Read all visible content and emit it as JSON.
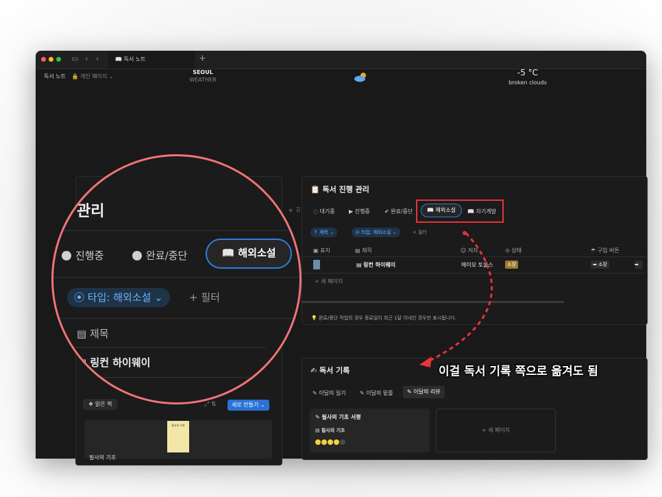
{
  "tab": {
    "title": "독서 노트"
  },
  "breadcrumb": {
    "page": "독서 노트",
    "workspace": "개인 페이지"
  },
  "weather": {
    "city": "SEOUL",
    "label": "WEATHER",
    "temp": "-5 °C",
    "desc": "broken clouds"
  },
  "progress": {
    "title": "독서 진행 관리",
    "views": [
      "대기중",
      "진행중",
      "완료/중단",
      "해외소설",
      "자기계발"
    ],
    "active_view": "해외소설",
    "sort_chip": "제목",
    "filter_chip": "타입: 해외소설",
    "add_filter": "필터",
    "columns": [
      "표지",
      "제목",
      "저자",
      "상태",
      "구입 버튼"
    ],
    "row": {
      "title": "링컨 하이웨이",
      "author": "에이모 토울스",
      "status": "소장",
      "buy": "소장"
    },
    "new_page": "새 페이지",
    "note": "완료/중단 작업의 경우 종료일이 최근 1달 이내인 경우만 표시됩니다."
  },
  "left": {
    "heading": "관리",
    "read_books": "읽은 책",
    "new_button": "새로 만들기",
    "card_title": "필사의 기초"
  },
  "magnifier": {
    "title": "관리",
    "tabs": [
      "진행중",
      "완료/중단"
    ],
    "active_tab": "해외소설",
    "filter_chip": "타입: 해외소설",
    "add_filter": "+ 필터",
    "column": "제목",
    "row": "링컨 하이웨이"
  },
  "log": {
    "title": "독서 기록",
    "tabs": [
      "이달의 일기",
      "이달의 밑줄",
      "이달의 리뷰"
    ],
    "active_tab": "이달의 리뷰",
    "card_title": "필사의 기초 서평",
    "card_sub": "필사의 기초",
    "rating": 4,
    "new_page": "새 페이지"
  },
  "annotation": "이걸 독서 기록 쪽으로 옮겨도 됨",
  "colors": {
    "accent": "#2f7fe0",
    "annotation_red": "#e5343a",
    "magnifier_ring": "#f07476"
  }
}
